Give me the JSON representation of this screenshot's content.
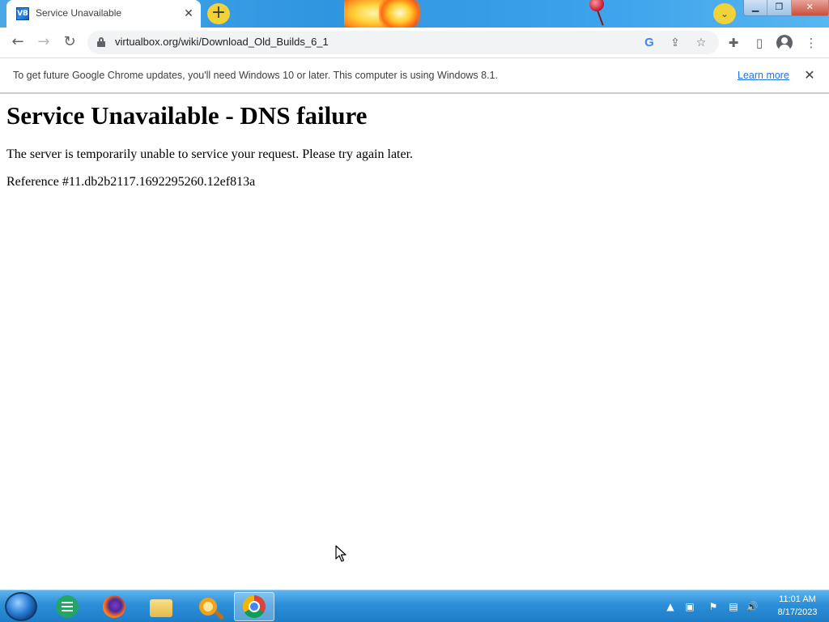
{
  "browser": {
    "tab": {
      "title": "Service Unavailable",
      "favicon_text": "VB",
      "close_glyph": "✕"
    },
    "new_tab_glyph": "+",
    "tab_search_glyph": "⌄",
    "window_controls": {
      "minimize": "▁",
      "maximize": "❐",
      "close": "✕"
    },
    "toolbar": {
      "back_glyph": "←",
      "forward_glyph": "→",
      "reload_glyph": "↻",
      "url": "virtualbox.org/wiki/Download_Old_Builds_6_1",
      "google_glyph": "G",
      "share_glyph": "⇪",
      "bookmark_glyph": "☆",
      "extensions_glyph": "✚",
      "sidepanel_glyph": "▯",
      "menu_glyph": "⋮"
    },
    "infobar": {
      "message": "To get future Google Chrome updates, you'll need Windows 10 or later. This computer is using Windows 8.1.",
      "learn_more": "Learn more",
      "close_glyph": "✕"
    }
  },
  "page": {
    "heading": "Service Unavailable - DNS failure",
    "message": "The server is temporarily unable to service your request. Please try again later.",
    "reference": "Reference #11.db2b2117.1692295260.12ef813a"
  },
  "taskbar": {
    "apps": [
      "sheets-icon",
      "firefox-icon",
      "file-explorer-icon",
      "magnifier-icon",
      "chrome-icon"
    ],
    "active_app": "chrome-icon",
    "tray": {
      "show_hidden": "▲",
      "flag": "⚑",
      "volume": "🔊"
    },
    "clock": {
      "time": "11:01 AM",
      "date": "8/17/2023"
    }
  },
  "colors": {
    "link": "#1a73e8",
    "taskbar": "#2c8fd8",
    "tab_search": "#f0d23a"
  }
}
